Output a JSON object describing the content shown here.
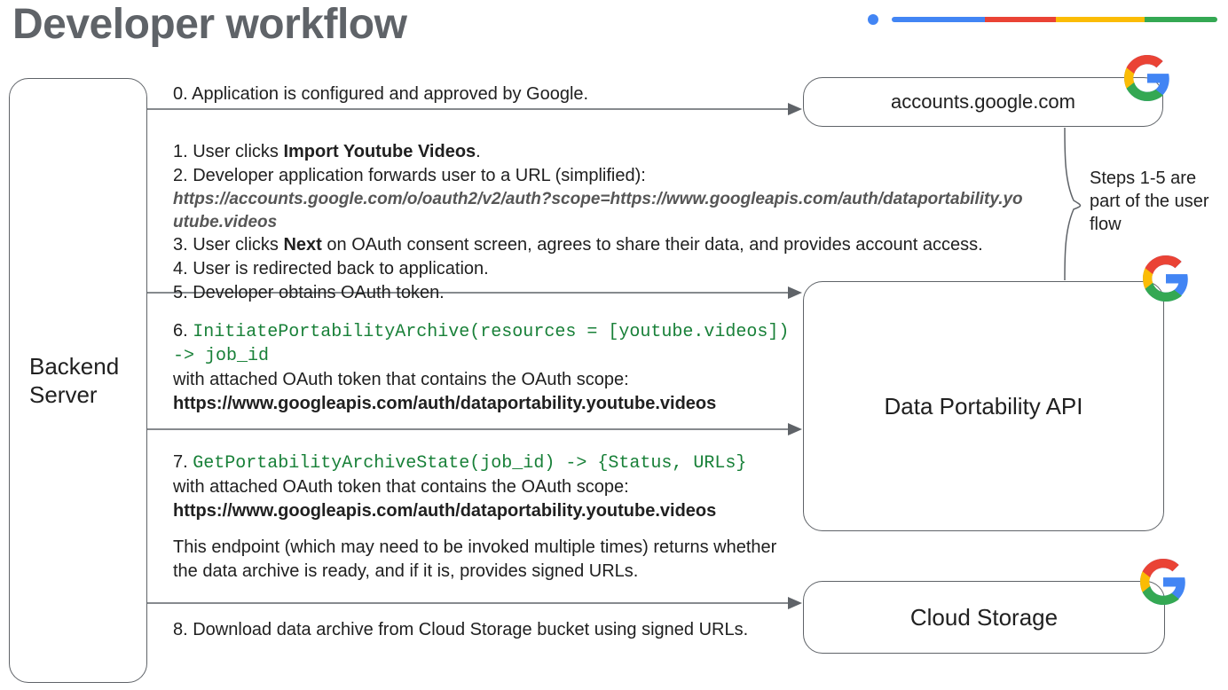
{
  "title": "Developer workflow",
  "backend_label": "Backend\nServer",
  "nodes": {
    "accounts": "accounts.google.com",
    "api": "Data Portability API",
    "storage": "Cloud Storage"
  },
  "side_note": "Steps 1-5 are part of the user flow",
  "step0": "0. Application is configured and approved by Google.",
  "block1": {
    "l1a": "1. User clicks ",
    "l1b": "Import Youtube Videos",
    "l1c": ".",
    "l2": "2. Developer application forwards user to a URL (simplified):",
    "url": "https://accounts.google.com/o/oauth2/v2/auth?scope=https://www.googleapis.com/auth/dataportability.youtube.videos",
    "l3a": "3. User clicks ",
    "l3b": "Next",
    "l3c": " on OAuth consent screen, agrees to share their data, and provides account access.",
    "l4": "4. User is redirected back to application.",
    "l5": "5. Developer obtains OAuth token."
  },
  "block6": {
    "num": "6. ",
    "code1": "InitiatePortabilityArchive(resources = [youtube.videos])",
    "code2": "-> job_id",
    "after": "with attached OAuth token that contains the OAuth scope:",
    "scope": "https://www.googleapis.com/auth/dataportability.youtube.videos"
  },
  "block7": {
    "num": "7. ",
    "code": "GetPortabilityArchiveState(job_id) -> {Status, URLs}",
    "after": "with attached OAuth token that contains the OAuth scope:",
    "scope": "https://www.googleapis.com/auth/dataportability.youtube.videos",
    "tail": "This endpoint (which may need to be invoked multiple times) returns whether the data archive is ready, and if it is, provides signed URLs."
  },
  "step8": "8. Download data archive from Cloud Storage bucket using signed URLs.",
  "colors": {
    "google_blue": "#4285F4",
    "google_red": "#EA4335",
    "google_yellow": "#FBBC05",
    "google_green": "#34A853",
    "arrow": "#5f6368"
  }
}
